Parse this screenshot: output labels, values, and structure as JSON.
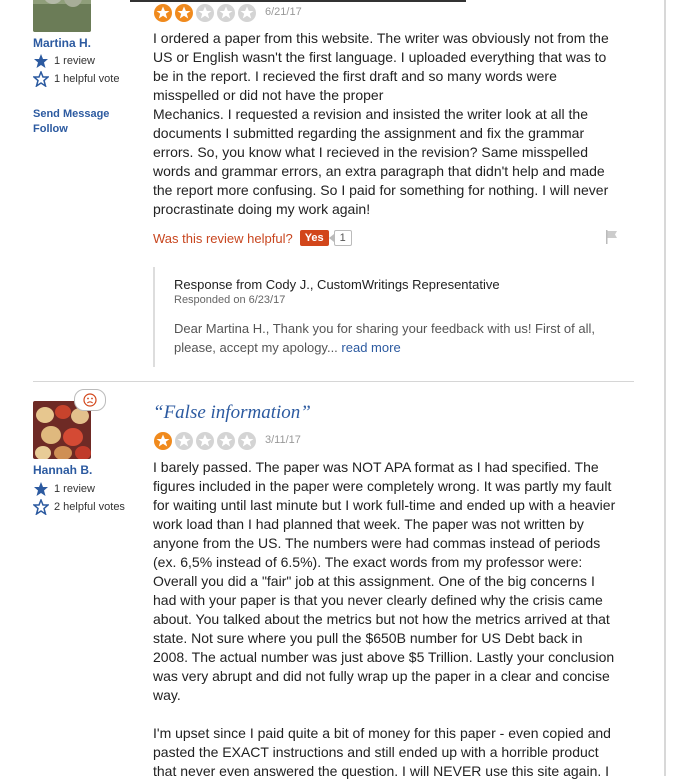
{
  "review1": {
    "user": {
      "name": "Martina H.",
      "reviews": "1 review",
      "helpful": "1 helpful vote"
    },
    "links": {
      "send_message": "Send Message",
      "follow": "Follow"
    },
    "rating": 2,
    "date": "6/21/17",
    "body": "I ordered a paper from this website. The writer was obviously not from the US or English wasn't the first language. I uploaded everything that was to be in the report. I recieved the first draft and so many words were misspelled or did not have the proper\nMechanics. I requested a revision and insisted the writer look at all the documents I submitted regarding the assignment and fix the grammar errors. So, you know what I recieved in the revision? Same misspelled words and grammar errors, an extra paragraph that didn't help and made the report more confusing. So I paid for something for nothing. I will never procrastinate doing my work again!",
    "helpful_prompt": "Was this review helpful?",
    "yes_label": "Yes",
    "yes_count": "1",
    "response": {
      "header": "Response from Cody J., CustomWritings Representative",
      "date": "Responded on 6/23/17",
      "text": "Dear Martina H., Thank you for sharing your feedback with us! First of all, please, accept my apology...",
      "read_more": "read more"
    }
  },
  "review2": {
    "user": {
      "name": "Hannah B.",
      "reviews": "1 review",
      "helpful": "2 helpful votes"
    },
    "title": "“False information”",
    "rating": 1,
    "date": "3/11/17",
    "body_p1": "I barely passed. The paper was NOT APA format as I had specified. The figures included in the paper were completely wrong. It was partly my fault for waiting until last minute but I work full-time and ended up with a heavier work load than I had planned that week. The paper was not written by anyone from the US. The numbers were had commas instead of periods (ex. 6,5% instead of 6.5%). The exact words from my professor were: Overall you did a \"fair\" job at this assignment. One of the big concerns I had with your paper is that you never clearly defined why the crisis came about. You talked about the metrics but not how the metrics arrived at that state. Not sure where you pull the $650B number for US Debt back in 2008. The actual number was just above $5 Trillion. Lastly your conclusion was very abrupt and did not fully wrap up the paper in a clear and concise way.",
    "body_p2": "I'm upset since I paid quite a bit of money for this paper - even copied and pasted the EXACT instructions and still ended up with a horrible product that never even answered the question. I will NEVER use this site again. I"
  },
  "colors": {
    "accent_blue": "#2c5aa0",
    "star_orange": "#f08a1d",
    "star_grey": "#d4d4d4",
    "helpful_red": "#c8461f",
    "yes_bg": "#d2461b"
  },
  "icons": {
    "stat_review": "star-icon",
    "stat_helpful": "star-outline-icon",
    "report": "flag-icon",
    "mood": "sad-face-icon"
  }
}
